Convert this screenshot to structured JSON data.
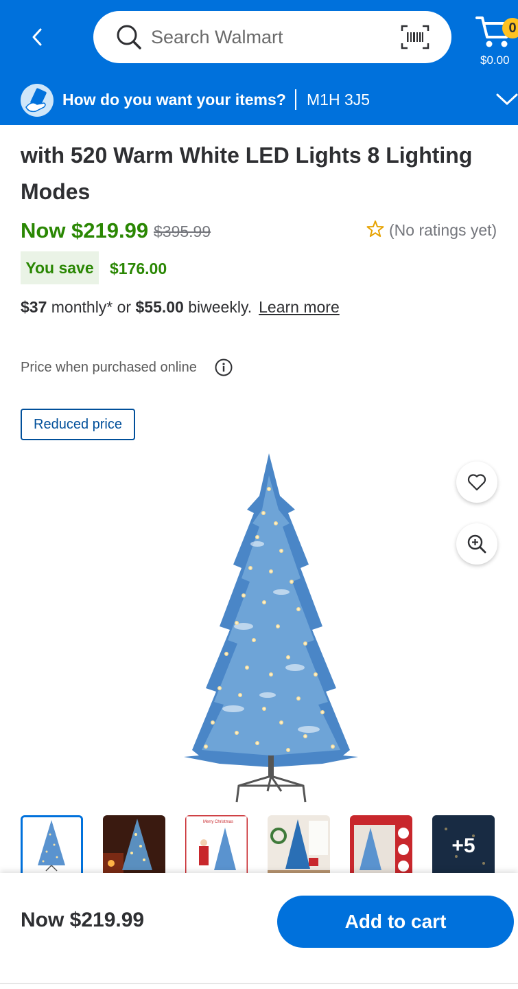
{
  "header": {
    "search_placeholder": "Search Walmart",
    "cart_count": "0",
    "cart_total": "$0.00"
  },
  "fulfillment": {
    "prompt": "How do you want your items?",
    "zip": "M1H 3J5"
  },
  "product": {
    "title": "with 520 Warm White LED Lights 8 Lighting Modes",
    "now_price": "Now $219.99",
    "was_price": "$395.99",
    "ratings": "(No ratings yet)",
    "you_save_label": "You save",
    "you_save_amount": "$176.00",
    "monthly_amount": "$37",
    "monthly_text": " monthly* or ",
    "biweekly_amount": "$55.00",
    "biweekly_text": " biweekly.",
    "learn_more": "Learn more",
    "price_note": "Price when purchased online",
    "reduced_tag": "Reduced price",
    "more_images": "+5"
  },
  "bottom_bar": {
    "price": "Now $219.99",
    "add_to_cart": "Add to cart"
  },
  "colors": {
    "brand_blue": "#0071dc",
    "price_green": "#2a8703",
    "spark_yellow": "#ffc220"
  },
  "icons": [
    "back-arrow-icon",
    "search-icon",
    "barcode-scanner-icon",
    "cart-icon",
    "fulfillment-icon",
    "chevron-down-icon",
    "star-outline-icon",
    "info-icon",
    "heart-icon",
    "zoom-in-icon"
  ]
}
